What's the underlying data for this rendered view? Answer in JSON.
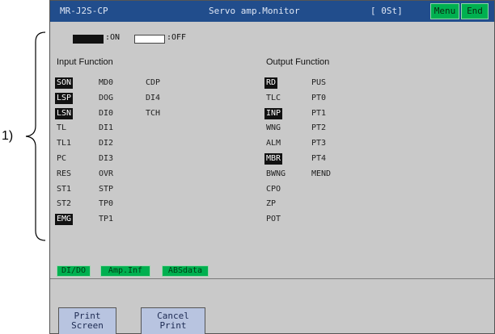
{
  "callout": "1)",
  "title_bar": {
    "model": "MR-J2S-CP",
    "title": "Servo amp.Monitor",
    "station": "[ 0St]",
    "menu_label": "Menu",
    "end_label": "End"
  },
  "legend": {
    "on_text": ":ON",
    "off_text": ":OFF"
  },
  "input": {
    "heading": "Input Function",
    "columns": [
      [
        {
          "label": "SON",
          "on": true
        },
        {
          "label": "LSP",
          "on": true
        },
        {
          "label": "LSN",
          "on": true
        },
        {
          "label": "TL",
          "on": false
        },
        {
          "label": "TL1",
          "on": false
        },
        {
          "label": "PC",
          "on": false
        },
        {
          "label": "RES",
          "on": false
        },
        {
          "label": "ST1",
          "on": false
        },
        {
          "label": "ST2",
          "on": false
        },
        {
          "label": "EMG",
          "on": true
        }
      ],
      [
        {
          "label": "MD0",
          "on": false
        },
        {
          "label": "DOG",
          "on": false
        },
        {
          "label": "DI0",
          "on": false
        },
        {
          "label": "DI1",
          "on": false
        },
        {
          "label": "DI2",
          "on": false
        },
        {
          "label": "DI3",
          "on": false
        },
        {
          "label": "OVR",
          "on": false
        },
        {
          "label": "STP",
          "on": false
        },
        {
          "label": "TP0",
          "on": false
        },
        {
          "label": "TP1",
          "on": false
        }
      ],
      [
        {
          "label": "CDP",
          "on": false
        },
        {
          "label": "DI4",
          "on": false
        },
        {
          "label": "TCH",
          "on": false
        }
      ]
    ]
  },
  "output": {
    "heading": "Output Function",
    "columns": [
      [
        {
          "label": "RD",
          "on": true
        },
        {
          "label": "TLC",
          "on": false
        },
        {
          "label": "INP",
          "on": true
        },
        {
          "label": "WNG",
          "on": false
        },
        {
          "label": "ALM",
          "on": false
        },
        {
          "label": "MBR",
          "on": true
        },
        {
          "label": "BWNG",
          "on": false
        },
        {
          "label": "CPO",
          "on": false
        },
        {
          "label": "ZP",
          "on": false
        },
        {
          "label": "POT",
          "on": false
        }
      ],
      [
        {
          "label": "PUS",
          "on": false
        },
        {
          "label": "PT0",
          "on": false
        },
        {
          "label": "PT1",
          "on": false
        },
        {
          "label": "PT2",
          "on": false
        },
        {
          "label": "PT3",
          "on": false
        },
        {
          "label": "PT4",
          "on": false
        },
        {
          "label": "MEND",
          "on": false
        }
      ]
    ]
  },
  "function_buttons": [
    "DI/DO",
    "Amp.Inf",
    "ABSdata"
  ],
  "bottom_buttons": {
    "print": "Print\nScreen",
    "cancel": "Cancel\nPrint"
  },
  "colors": {
    "title_bar": "#214d8c",
    "accent_green": "#00b050",
    "screen_bg": "#c9c9c9",
    "bottom_button": "#b8c4e0",
    "signal_on": "#111111"
  }
}
